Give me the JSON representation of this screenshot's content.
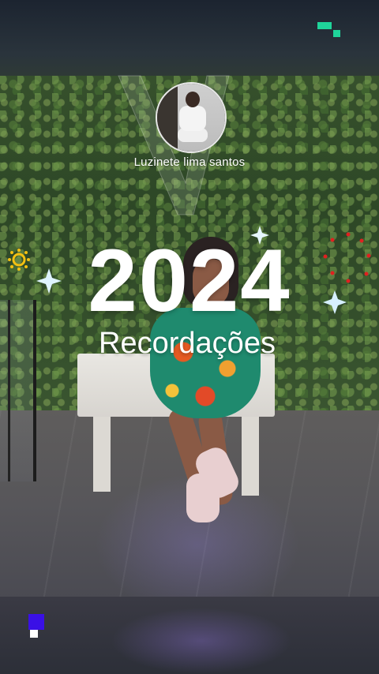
{
  "story": {
    "user_name": "Luzinete lima santos",
    "title_year": "2024",
    "title_label": "Recordações"
  },
  "icons": {
    "brand_mark": "green-pixel-logo-icon",
    "app_mark": "blue-square-logo-icon",
    "sparkles": [
      "sparkle-icon",
      "firework-icon",
      "sun-icon"
    ]
  },
  "colors": {
    "brand_green": "#1fd49a",
    "app_blue": "#3a10e6",
    "sparkle_blue": "#bfe6ff",
    "firework_red": "#e02020",
    "sun_yellow": "#f3c012"
  }
}
